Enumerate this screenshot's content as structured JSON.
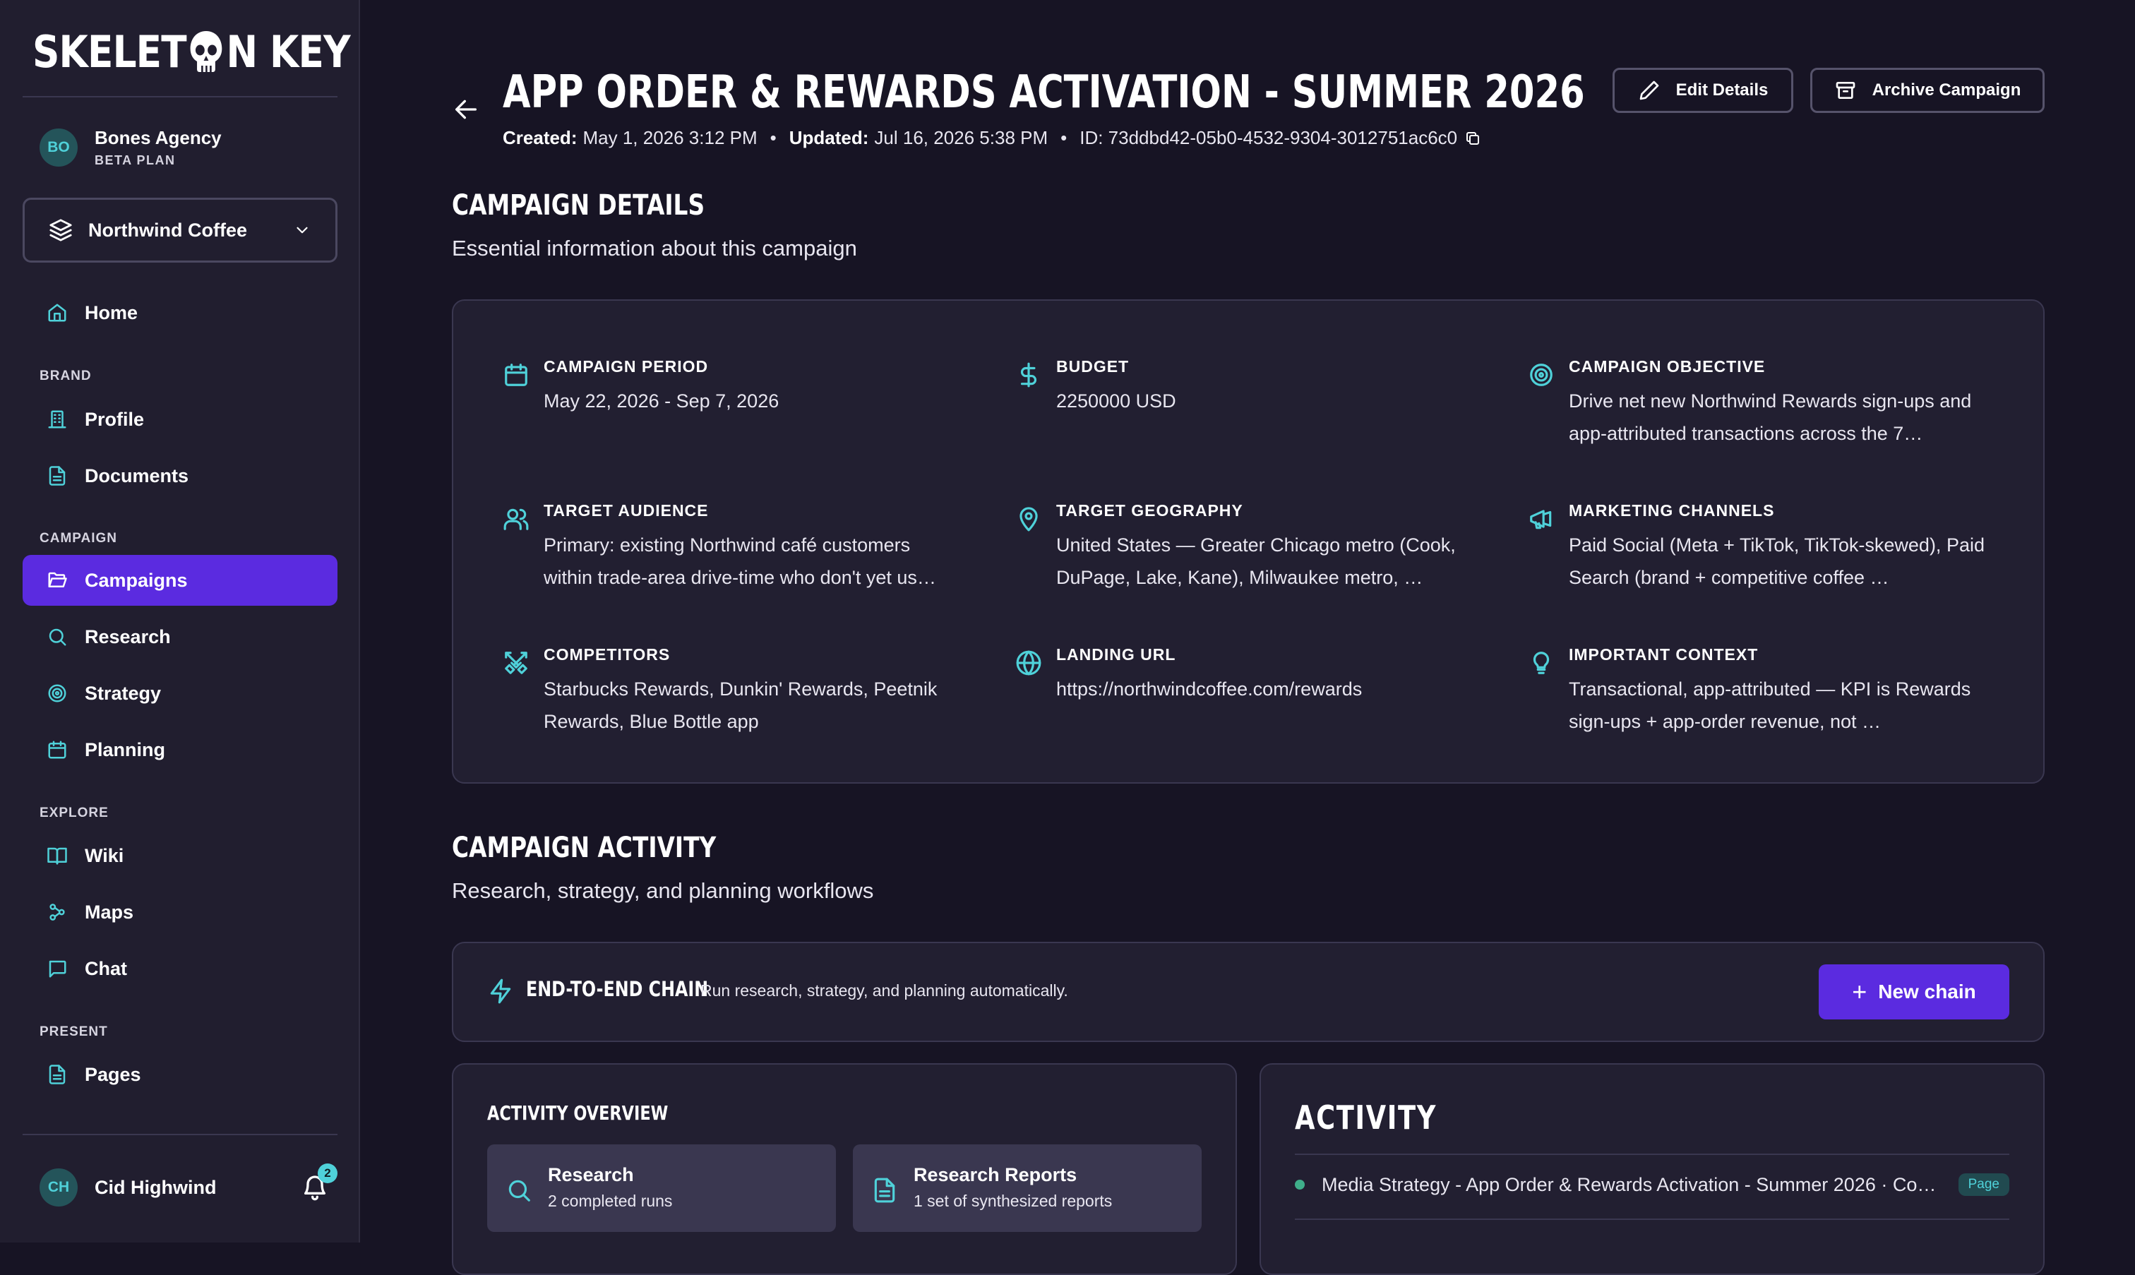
{
  "app": {
    "logo": "SKELETON KEY"
  },
  "sidebar": {
    "agency": {
      "initials": "BO",
      "name": "Bones Agency",
      "plan": "BETA PLAN"
    },
    "brand_selector": {
      "value": "Northwind Coffee"
    },
    "home": "Home",
    "sections": {
      "brand": "BRAND",
      "campaign": "CAMPAIGN",
      "explore": "EXPLORE",
      "present": "PRESENT"
    },
    "items": {
      "profile": "Profile",
      "documents": "Documents",
      "campaigns": "Campaigns",
      "research": "Research",
      "strategy": "Strategy",
      "planning": "Planning",
      "wiki": "Wiki",
      "maps": "Maps",
      "chat": "Chat",
      "pages": "Pages"
    },
    "user": {
      "initials": "CH",
      "name": "Cid Highwind",
      "notifications": "2"
    }
  },
  "header": {
    "title": "APP ORDER & REWARDS ACTIVATION - SUMMER 2026",
    "created_label": "Created:",
    "created": "May 1, 2026 3:12 PM",
    "updated_label": "Updated:",
    "updated": "Jul 16, 2026 5:38 PM",
    "id_text": "ID: 73ddbd42-05b0-4532-9304-3012751ac6c0",
    "edit_label": "Edit Details",
    "archive_label": "Archive Campaign"
  },
  "details_section": {
    "title": "CAMPAIGN DETAILS",
    "subtitle": "Essential information about this campaign",
    "fields": {
      "period": {
        "label": "CAMPAIGN PERIOD",
        "value": "May 22, 2026 - Sep 7, 2026"
      },
      "budget": {
        "label": "BUDGET",
        "value": "2250000 USD"
      },
      "objective": {
        "label": "CAMPAIGN OBJECTIVE",
        "value": "Drive net new Northwind Rewards sign-ups and app-attributed transactions across the 7…"
      },
      "audience": {
        "label": "TARGET AUDIENCE",
        "value": "Primary: existing Northwind café customers within trade-area drive-time who don't yet us…"
      },
      "geography": {
        "label": "TARGET GEOGRAPHY",
        "value": "United States — Greater Chicago metro (Cook, DuPage, Lake, Kane), Milwaukee metro, …"
      },
      "channels": {
        "label": "MARKETING CHANNELS",
        "value": "Paid Social (Meta + TikTok, TikTok-skewed), Paid Search (brand + competitive coffee …"
      },
      "competitors": {
        "label": "COMPETITORS",
        "value": "Starbucks Rewards, Dunkin' Rewards, Peetnik Rewards, Blue Bottle app"
      },
      "landing": {
        "label": "LANDING URL",
        "value": "https://northwindcoffee.com/rewards"
      },
      "context": {
        "label": "IMPORTANT CONTEXT",
        "value": "Transactional, app-attributed — KPI is Rewards sign-ups + app-order revenue, not …"
      }
    }
  },
  "activity_section": {
    "title": "CAMPAIGN ACTIVITY",
    "subtitle": "Research, strategy, and planning workflows",
    "chain": {
      "title": "END-TO-END CHAIN",
      "description": "Run research, strategy, and planning automatically.",
      "button": "New chain"
    },
    "overview": {
      "title": "ACTIVITY OVERVIEW",
      "tiles": [
        {
          "title": "Research",
          "subtitle": "2 completed runs"
        },
        {
          "title": "Research Reports",
          "subtitle": "1 set of synthesized reports"
        }
      ]
    },
    "activity": {
      "title": "ACTIVITY",
      "items": [
        {
          "text": "Media Strategy - App Order & Rewards Activation - Summer 2026 · Co…",
          "tag": "Page"
        }
      ]
    }
  },
  "colors": {
    "accent": "#5b2be0",
    "teal": "#4fd1d9",
    "background": "#171424",
    "sidebar": "#211e2f"
  }
}
